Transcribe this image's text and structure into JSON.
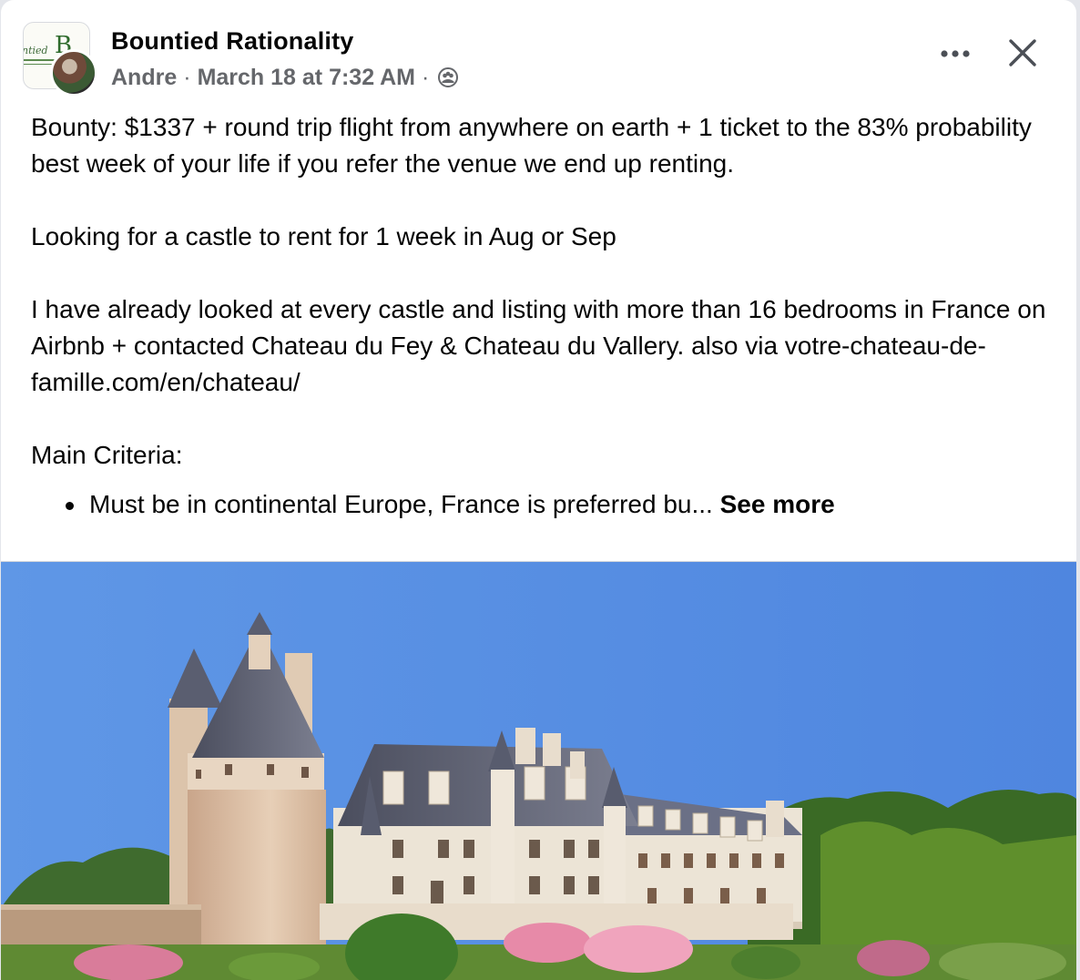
{
  "post": {
    "group_name": "Bountied Rationality",
    "author": "Andre",
    "timestamp": "March 18 at 7:32 AM",
    "separator": "·",
    "privacy_icon": "group-members-icon",
    "more_icon": "more-horizontal-icon",
    "close_icon": "close-icon",
    "body": {
      "p1": "Bounty: $1337 + round trip flight from anywhere on earth + 1 ticket to the 83% probability best week of your life if you refer the venue we end up renting.",
      "p2": "Looking for a castle to rent for 1 week in Aug or Sep",
      "p3": "I have already looked at every castle and listing with more than 16 bedrooms in France on Airbnb + contacted Chateau du Fey & Chateau du Vallery. also via votre-chateau-de-famille.com/en/chateau/",
      "criteria_heading": "Main Criteria:",
      "criteria": [
        {
          "text": "Must be in continental Europe, France is preferred bu... ",
          "see_more": "See more"
        }
      ]
    },
    "group_logo_text": "ntied B",
    "photo_subject": "castle photo"
  }
}
